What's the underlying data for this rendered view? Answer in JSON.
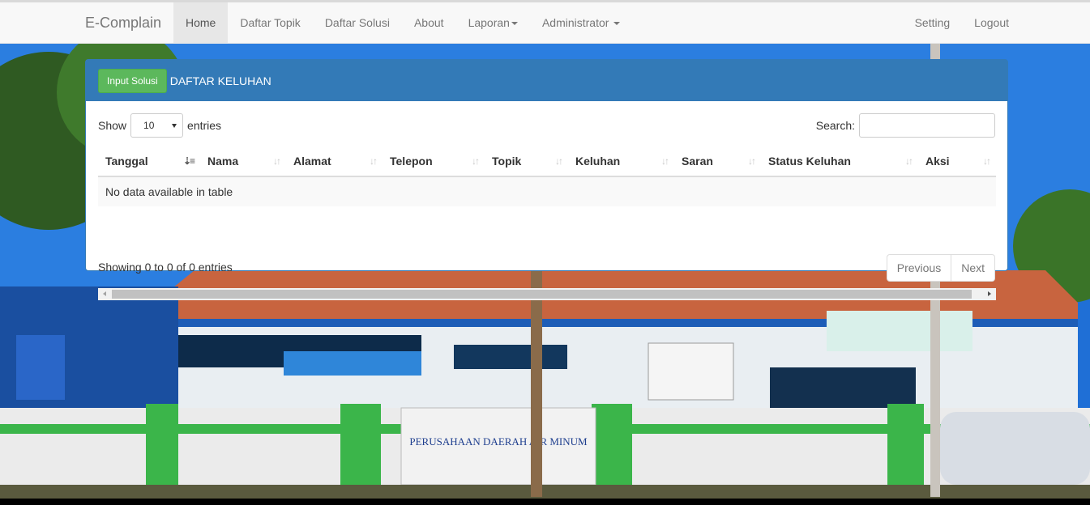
{
  "navbar": {
    "brand": "E-Complain",
    "left_items": [
      {
        "label": "Home",
        "active": true,
        "dropdown": false
      },
      {
        "label": "Daftar Topik",
        "active": false,
        "dropdown": false
      },
      {
        "label": "Daftar Solusi",
        "active": false,
        "dropdown": false
      },
      {
        "label": "About",
        "active": false,
        "dropdown": false
      },
      {
        "label": "Laporan",
        "active": false,
        "dropdown": true
      },
      {
        "label": "Administrator",
        "active": false,
        "dropdown": true
      }
    ],
    "right_items": [
      {
        "label": "Setting"
      },
      {
        "label": "Logout"
      }
    ]
  },
  "panel": {
    "button_label": "Input Solusi",
    "title": "DAFTAR KELUHAN"
  },
  "table_controls": {
    "show_label": "Show",
    "entries_value": "10",
    "entries_label": "entries",
    "search_label": "Search:"
  },
  "table": {
    "columns": [
      "Tanggal",
      "Nama",
      "Alamat",
      "Telepon",
      "Topik",
      "Keluhan",
      "Saran",
      "Status Keluhan",
      "Aksi"
    ],
    "sorted_column": 0,
    "empty_message": "No data available in table"
  },
  "footer": {
    "info": "Showing 0 to 0 of 0 entries",
    "previous": "Previous",
    "next": "Next"
  },
  "background": {
    "sign_text": "PERUSAHAAN DAERAH AIR MINUM",
    "colors": {
      "sky": "#1f6fd6",
      "roof": "#c8643f",
      "wall": "#f2f2f2",
      "green": "#3bb54a"
    }
  }
}
